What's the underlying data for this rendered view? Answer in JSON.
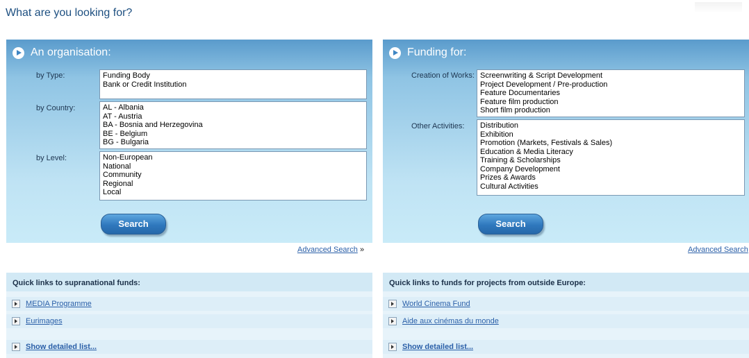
{
  "page": {
    "title": "What are you looking for?"
  },
  "organisation": {
    "heading": "An organisation:",
    "type_label": "by Type:",
    "type_options": [
      "Funding Body",
      "Bank or Credit Institution"
    ],
    "country_label": "by Country:",
    "country_options": [
      "AL - Albania",
      "AT - Austria",
      "BA - Bosnia and Herzegovina",
      "BE - Belgium",
      "BG - Bulgaria"
    ],
    "level_label": "by Level:",
    "level_options": [
      "Non-European",
      "National",
      "Community",
      "Regional",
      "Local"
    ],
    "search_label": "Search",
    "advanced_label": "Advanced Search",
    "advanced_suffix": "»"
  },
  "funding": {
    "heading": "Funding for:",
    "works_label": "Creation of Works:",
    "works_options": [
      "Screenwriting & Script Development",
      "Project Development / Pre-production",
      "Feature Documentaries",
      "Feature film production",
      "Short film production"
    ],
    "activities_label": "Other Activities:",
    "activities_options": [
      "Distribution",
      "Exhibition",
      "Promotion (Markets, Festivals & Sales)",
      "Education & Media Literacy",
      "Training & Scholarships",
      "Company Development",
      "Prizes & Awards",
      "Cultural Activities"
    ],
    "search_label": "Search",
    "advanced_label": "Advanced Search"
  },
  "quicklinks_supranational": {
    "heading": "Quick links to supranational funds:",
    "links": [
      "MEDIA Programme",
      "Eurimages"
    ],
    "detail_label": "Show detailed list..."
  },
  "quicklinks_outside": {
    "heading": "Quick links to funds for projects from outside Europe:",
    "links": [
      "World Cinema Fund",
      "Aide aux cinémas du monde"
    ],
    "detail_label": "Show detailed list..."
  }
}
